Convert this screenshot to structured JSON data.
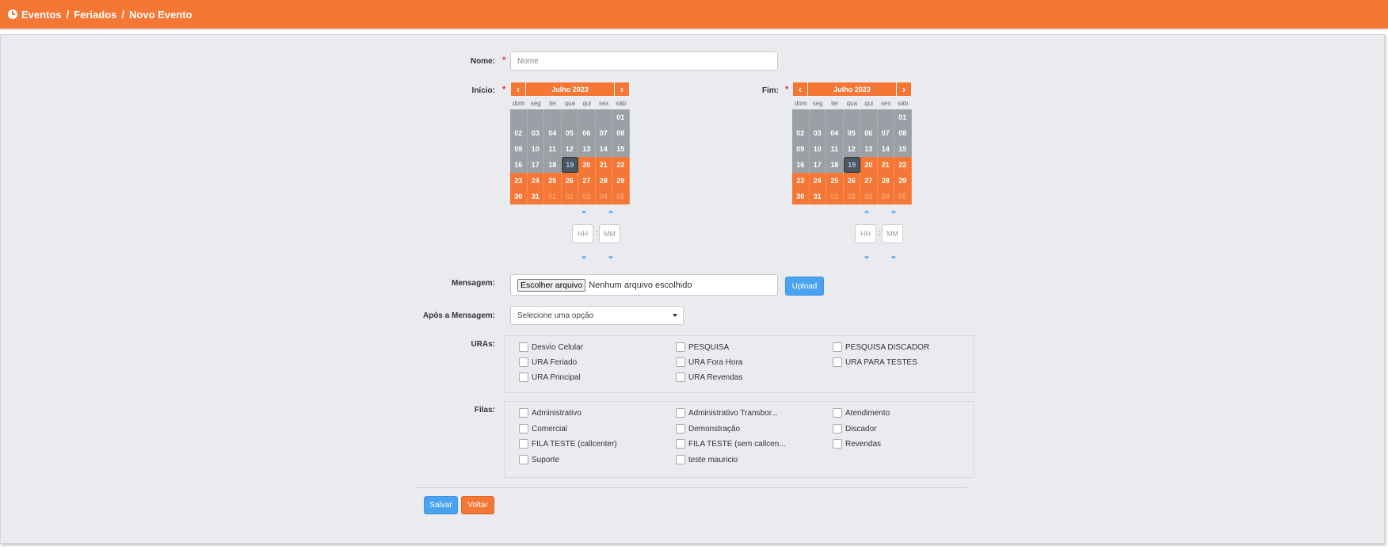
{
  "header": {
    "breadcrumb": [
      "Eventos",
      "Feriados",
      "Novo Evento"
    ],
    "separator": "/",
    "icon": "clock-icon"
  },
  "form": {
    "nome": {
      "label": "Nome:",
      "required": "*",
      "placeholder": "Nome"
    },
    "inicio": {
      "label": "Início:",
      "required": "*"
    },
    "fim": {
      "label": "Fim:",
      "required": "*"
    },
    "calendar": {
      "title": "Julho 2023",
      "prev": "‹",
      "next": "›",
      "weekdays": [
        "dom",
        "seg",
        "ter",
        "qua",
        "qui",
        "sex",
        "sáb"
      ],
      "weeks": [
        [
          "",
          "",
          "",
          "",
          "",
          "",
          "01"
        ],
        [
          "02",
          "03",
          "04",
          "05",
          "06",
          "07",
          "08"
        ],
        [
          "09",
          "10",
          "11",
          "12",
          "13",
          "14",
          "15"
        ],
        [
          "16",
          "17",
          "18",
          "19",
          "20",
          "21",
          "22"
        ],
        [
          "23",
          "24",
          "25",
          "26",
          "27",
          "28",
          "29"
        ],
        [
          "30",
          "31",
          "01",
          "02",
          "03",
          "04",
          "05"
        ]
      ],
      "today": "19",
      "time": {
        "hour_placeholder": "HH",
        "minute_placeholder": "MM",
        "separator": ":"
      }
    },
    "mensagem": {
      "label": "Mensagem:",
      "file_button": "Escolher arquivo",
      "file_status": "Nenhum arquivo escolhido",
      "upload": "Upload"
    },
    "apos": {
      "label": "Após a Mensagem:",
      "selected": "Selecione uma opção"
    },
    "uras": {
      "label": "URAs:",
      "items": [
        "Desvio Celular",
        "PESQUISA",
        "PESQUISA DISCADOR",
        "URA Feriado",
        "URA Fora Hora",
        "URA PARA TESTES",
        "URA Principal",
        "URA Revendas"
      ]
    },
    "filas": {
      "label": "Filas:",
      "items": [
        "Administrativo",
        "Administrativo Transbor...",
        "Atendimento",
        "Comercial",
        "Demonstração",
        "Discador",
        "FILA TESTE (callcenter)",
        "FILA TESTE (sem callcen...",
        "Revendas",
        "Suporte",
        "teste mauricio"
      ]
    },
    "buttons": {
      "save": "Salvar",
      "back": "Voltar"
    }
  },
  "colors": {
    "accent": "#f47736",
    "primary": "#4aa3f0",
    "panel": "#e9ebee",
    "calendar_past": "#9ba0a6",
    "today": "#4d5660"
  }
}
